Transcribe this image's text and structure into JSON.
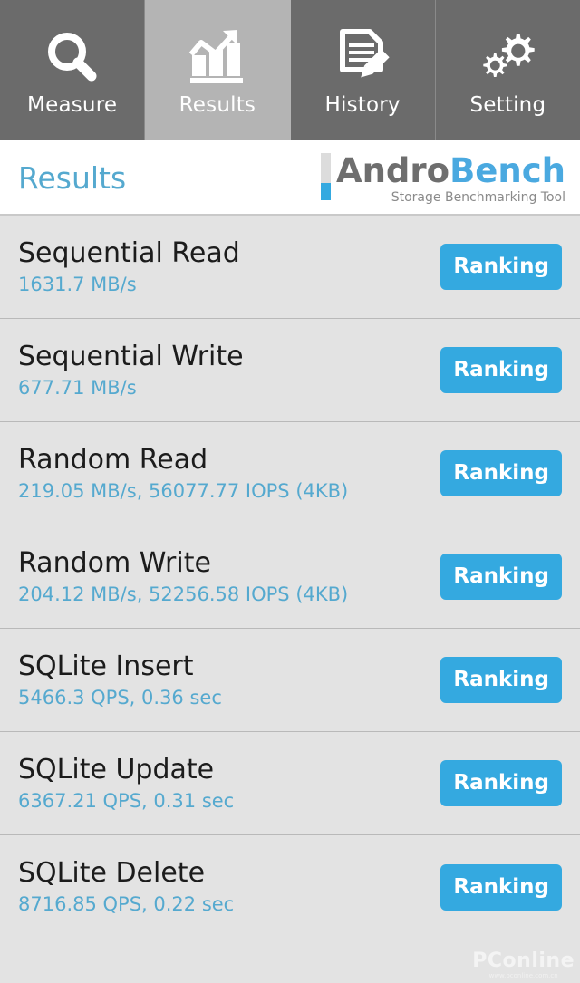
{
  "navbar": {
    "tabs": [
      {
        "label": "Measure",
        "icon": "magnifier-icon",
        "active": false
      },
      {
        "label": "Results",
        "icon": "bar-chart-icon",
        "active": true
      },
      {
        "label": "History",
        "icon": "document-pencil-icon",
        "active": false
      },
      {
        "label": "Setting",
        "icon": "gears-icon",
        "active": false
      }
    ]
  },
  "header": {
    "page_title": "Results",
    "logo": {
      "word_primary": "Andro",
      "word_secondary": "Bench",
      "tagline": "Storage Benchmarking Tool"
    }
  },
  "results": {
    "ranking_label": "Ranking",
    "rows": [
      {
        "name": "Sequential Read",
        "value": "1631.7 MB/s"
      },
      {
        "name": "Sequential Write",
        "value": "677.71 MB/s"
      },
      {
        "name": "Random Read",
        "value": "219.05 MB/s, 56077.77 IOPS (4KB)"
      },
      {
        "name": "Random Write",
        "value": "204.12 MB/s, 52256.58 IOPS (4KB)"
      },
      {
        "name": "SQLite Insert",
        "value": "5466.3 QPS, 0.36 sec"
      },
      {
        "name": "SQLite Update",
        "value": "6367.21 QPS, 0.31 sec"
      },
      {
        "name": "SQLite Delete",
        "value": "8716.85 QPS, 0.22 sec"
      }
    ]
  },
  "watermark": {
    "text": "PConline",
    "subtext": "www.pconline.com.cn"
  },
  "colors": {
    "accent_blue": "#34a9e0",
    "value_blue": "#55a9cf",
    "nav_bg": "#6b6b6b",
    "nav_active_bg": "#b4b4b4",
    "list_bg": "#e3e3e3"
  }
}
